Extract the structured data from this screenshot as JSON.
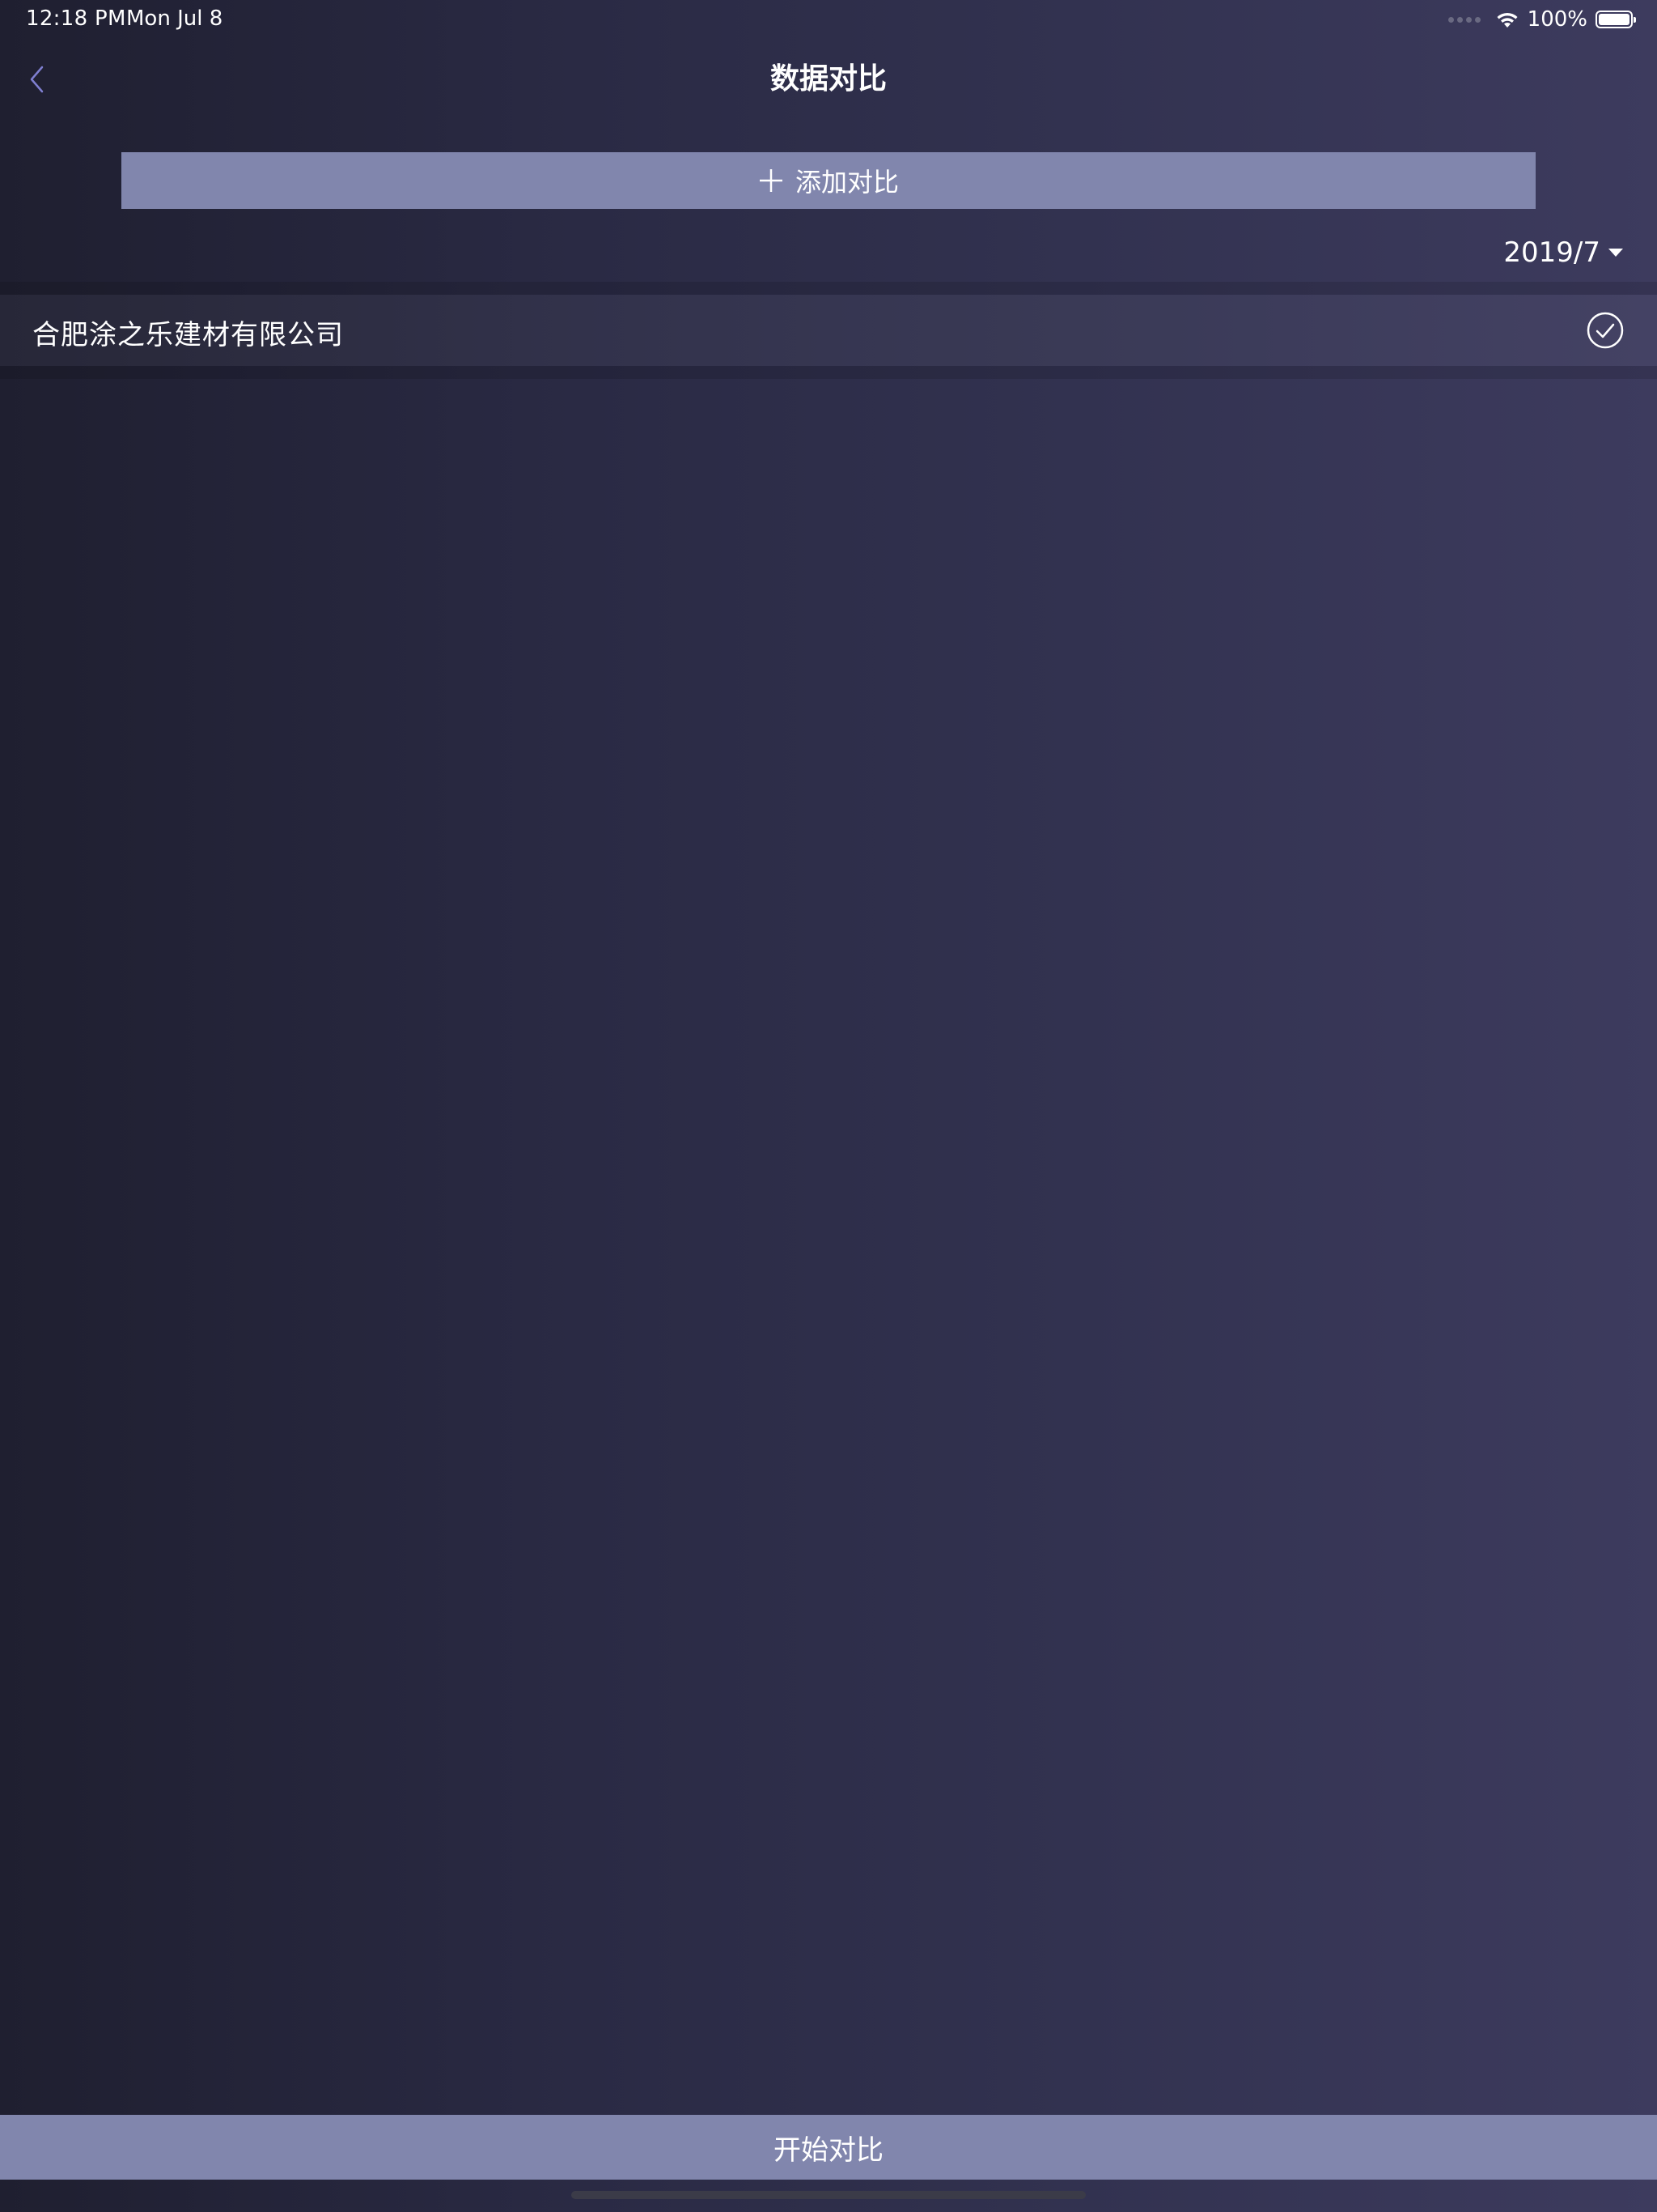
{
  "status_bar": {
    "time": "12:18 PM",
    "date": "Mon Jul 8",
    "battery": "100%",
    "icons": [
      "signal-icon",
      "wifi-icon",
      "battery-icon"
    ]
  },
  "nav": {
    "title": "数据对比",
    "back_icon": "chevron-left-icon"
  },
  "toolbar": {
    "add_compare_label": "添加对比",
    "add_icon": "plus-icon"
  },
  "filter": {
    "month": "2019/7"
  },
  "companies": [
    {
      "name": "合肥涂之乐建材有限公司",
      "selected": true
    }
  ],
  "footer": {
    "start_compare_label": "开始对比"
  },
  "colors": {
    "background_left": "#1f1f30",
    "background_right": "#3d3b5e",
    "button": "#8186ad",
    "accent_back": "#7f7fd0"
  }
}
